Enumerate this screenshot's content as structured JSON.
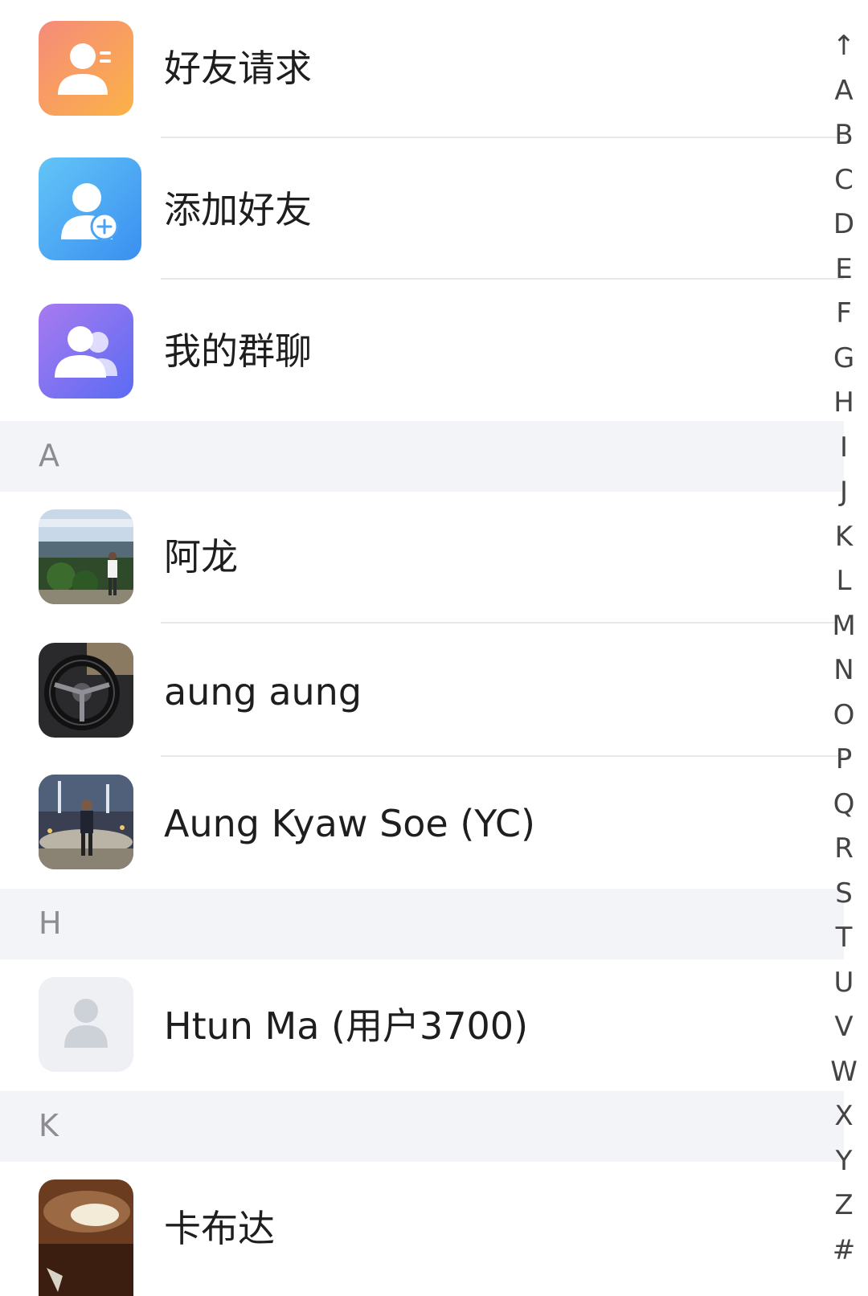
{
  "menu": {
    "friend_request": "好友请求",
    "add_friend": "添加好友",
    "my_groups": "我的群聊"
  },
  "sections": {
    "a": "A",
    "h": "H",
    "k": "K"
  },
  "contacts": {
    "a_long": "阿龙",
    "aung_aung": "aung aung",
    "aung_kyaw_soe": "Aung Kyaw Soe (YC)",
    "htun_ma": "Htun Ma (用户3700)",
    "kabuda": "卡布达"
  },
  "index": [
    "↑",
    "A",
    "B",
    "C",
    "D",
    "E",
    "F",
    "G",
    "H",
    "I",
    "J",
    "K",
    "L",
    "M",
    "N",
    "O",
    "P",
    "Q",
    "R",
    "S",
    "T",
    "U",
    "V",
    "W",
    "X",
    "Y",
    "Z",
    "#"
  ],
  "colors": {
    "friend_request_icon": "#f7a36b",
    "add_friend_icon": "#4aa3f5",
    "my_groups_icon": "#7b6cf3",
    "section_bg": "#f3f4f7",
    "default_avatar_bg": "#eef0f4"
  }
}
